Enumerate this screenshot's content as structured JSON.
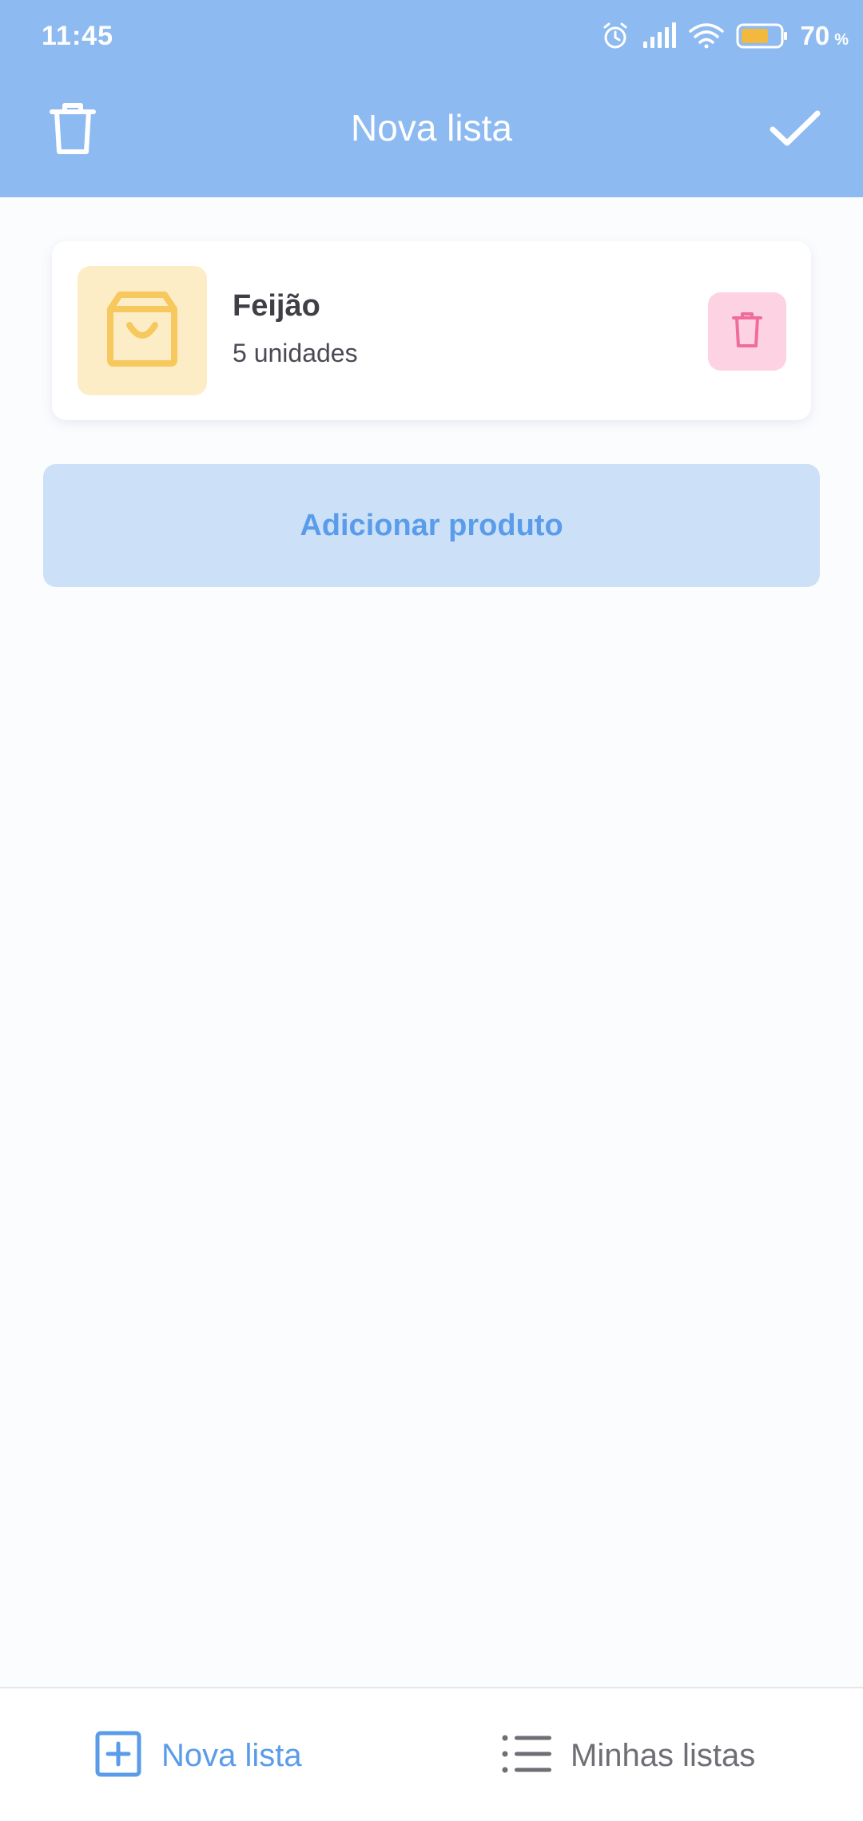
{
  "status_bar": {
    "time": "11:45",
    "battery": "70",
    "battery_unit": "%",
    "icons": [
      "alarm-icon",
      "signal-icon",
      "wifi-icon",
      "battery-icon"
    ]
  },
  "app_bar": {
    "title": "Nova lista",
    "left_icon": "trash-icon",
    "right_icon": "check-icon"
  },
  "products": [
    {
      "name": "Feijão",
      "quantity": "5 unidades",
      "icon": "shopping-bag-icon"
    }
  ],
  "add_button": {
    "label": "Adicionar produto"
  },
  "bottom_nav": {
    "items": [
      {
        "label": "Nova lista",
        "icon": "plus-square-icon",
        "active": true
      },
      {
        "label": "Minhas listas",
        "icon": "list-icon",
        "active": false
      }
    ]
  },
  "colors": {
    "header": "#8DBAF0",
    "accent": "#5A9CEA",
    "thumb_bg": "#FDEDC6",
    "bag_icon": "#F7C85E",
    "delete_bg": "#FDD2E2",
    "delete_icon": "#F06C9B",
    "add_button_bg": "#CCE1F8",
    "background": "#FBFCFE"
  }
}
